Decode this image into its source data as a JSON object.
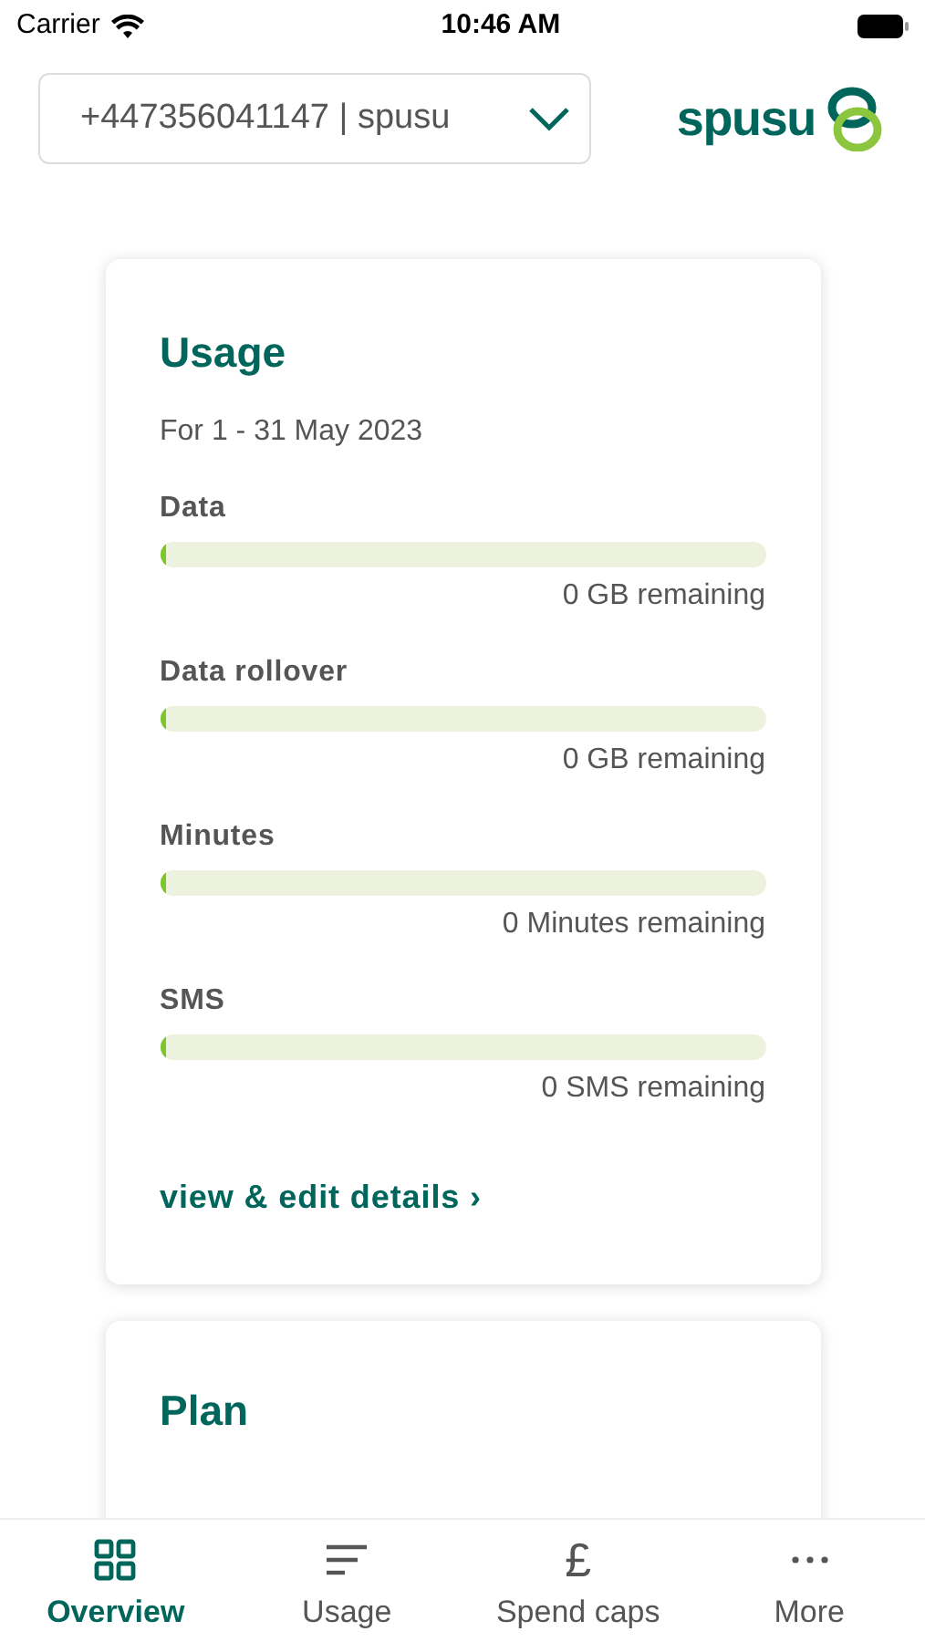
{
  "status_bar": {
    "carrier": "Carrier",
    "time": "10:46 AM"
  },
  "header": {
    "account": "+447356041147 | spusu",
    "logo": "spusu"
  },
  "usage": {
    "title": "Usage",
    "period": "For 1 - 31 May 2023",
    "meters": [
      {
        "name": "Data",
        "level": 0.01,
        "reading": "0 GB remaining"
      },
      {
        "name": "Data rollover",
        "level": 0.01,
        "reading": "0 GB remaining"
      },
      {
        "name": "Minutes",
        "level": 0.01,
        "reading": "0 Minutes remaining"
      },
      {
        "name": "SMS",
        "level": 0.01,
        "reading": "0 SMS remaining"
      }
    ],
    "link": "view & edit details ›"
  },
  "plan": {
    "title": "Plan"
  },
  "tabs": [
    {
      "label": "Overview",
      "kind": "grid",
      "selected": true
    },
    {
      "label": "Usage",
      "kind": "lines",
      "selected": false
    },
    {
      "label": "Spend caps",
      "kind": "pound",
      "glyph": "£",
      "selected": false
    },
    {
      "label": "More",
      "kind": "dots",
      "selected": false
    }
  ]
}
